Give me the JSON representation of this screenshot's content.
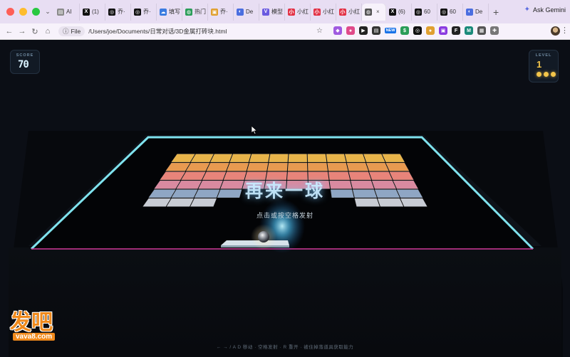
{
  "browser": {
    "tabs": [
      {
        "label": "AI",
        "icon": "doc-icon",
        "color": "#8a8a8a"
      },
      {
        "label": "(1)",
        "icon": "x-icon",
        "color": "#111111"
      },
      {
        "label": "乔·",
        "icon": "openai-icon",
        "color": "#111111"
      },
      {
        "label": "乔·",
        "icon": "openai-icon",
        "color": "#111111"
      },
      {
        "label": "填写",
        "icon": "cloud-icon",
        "color": "#3a7be0"
      },
      {
        "label": "热门",
        "icon": "globe-icon",
        "color": "#2a9d58"
      },
      {
        "label": "乔·",
        "icon": "photo-icon",
        "color": "#e0a030"
      },
      {
        "label": "De",
        "icon": "deepseek-icon",
        "color": "#4a6ee0"
      },
      {
        "label": "模型",
        "icon": "v-icon",
        "color": "#6a5ae0"
      },
      {
        "label": "小红",
        "icon": "rednote-icon",
        "color": "#e23044"
      },
      {
        "label": "小红",
        "icon": "rednote-icon",
        "color": "#e23044"
      },
      {
        "label": "小红",
        "icon": "rednote-icon",
        "color": "#e23044"
      },
      {
        "label": "",
        "icon": "globe-icon",
        "color": "#555555",
        "active": true
      },
      {
        "label": "(6)",
        "icon": "x-icon",
        "color": "#111111"
      },
      {
        "label": "60",
        "icon": "openai-icon",
        "color": "#111111"
      },
      {
        "label": "60",
        "icon": "openai-icon",
        "color": "#111111"
      },
      {
        "label": "De",
        "icon": "deepseek-icon",
        "color": "#4a6ee0"
      }
    ],
    "ask_gemini": "Ask Gemini",
    "file_chip": "File",
    "url": "/Users/joe/Documents/日常对话/3D金属打砖块.html",
    "new_badge": "NEW"
  },
  "game": {
    "score_label": "SCORE",
    "score": "70",
    "level_label": "LEVEL",
    "level": "1",
    "lives": 3,
    "overlay_title": "再来一球",
    "overlay_subtitle": "点击或按空格发射",
    "hint": "← → / A D 移动  ·  空格发射  ·  R 重开  ·  被住掉落道具获取能力",
    "brick_row_colors": [
      "#e8b44a",
      "#e89a50",
      "#e8847a",
      "#d98aa0",
      "#8fa6c4",
      "#c8ccd4"
    ],
    "accent_color": "#7fe3ee"
  },
  "watermark": {
    "main": "发吧",
    "sub": "vava8.com"
  }
}
